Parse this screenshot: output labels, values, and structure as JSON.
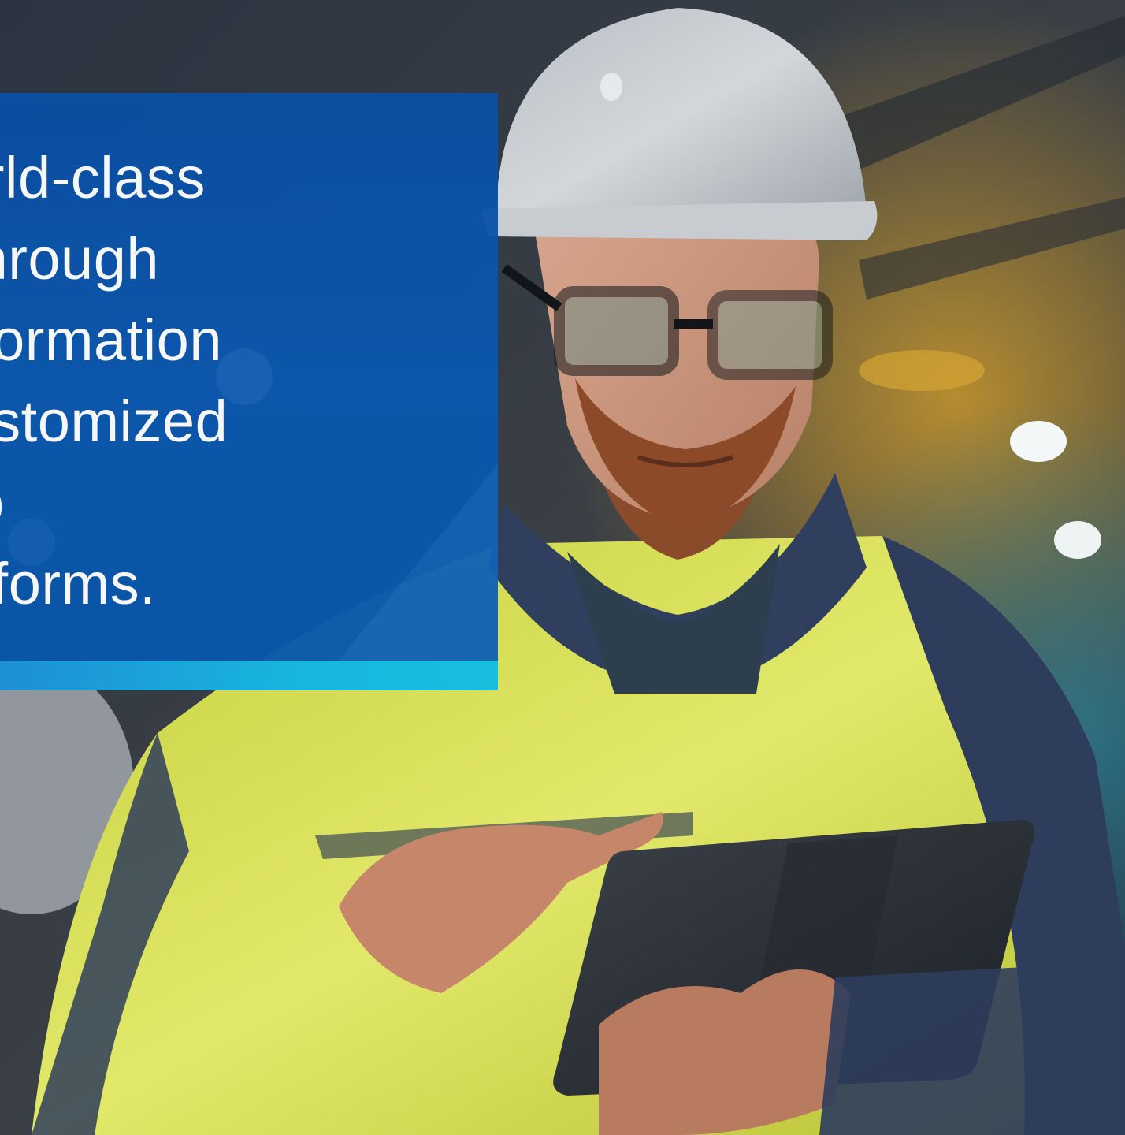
{
  "hero": {
    "image_description_icon": "engineer-with-tablet-photo",
    "colors": {
      "panel_blue": "#0a4fa3",
      "accent_cyan": "#19bedf",
      "jacket_yellow": "#d7e04a",
      "hard_hat": "#c9cdd2",
      "headline_text": "#ffffff"
    }
  },
  "headline": {
    "lines": [
      "lop world-class",
      " apps through",
      "l transformation",
      " and customized",
      "nd web",
      "on platforms."
    ]
  }
}
